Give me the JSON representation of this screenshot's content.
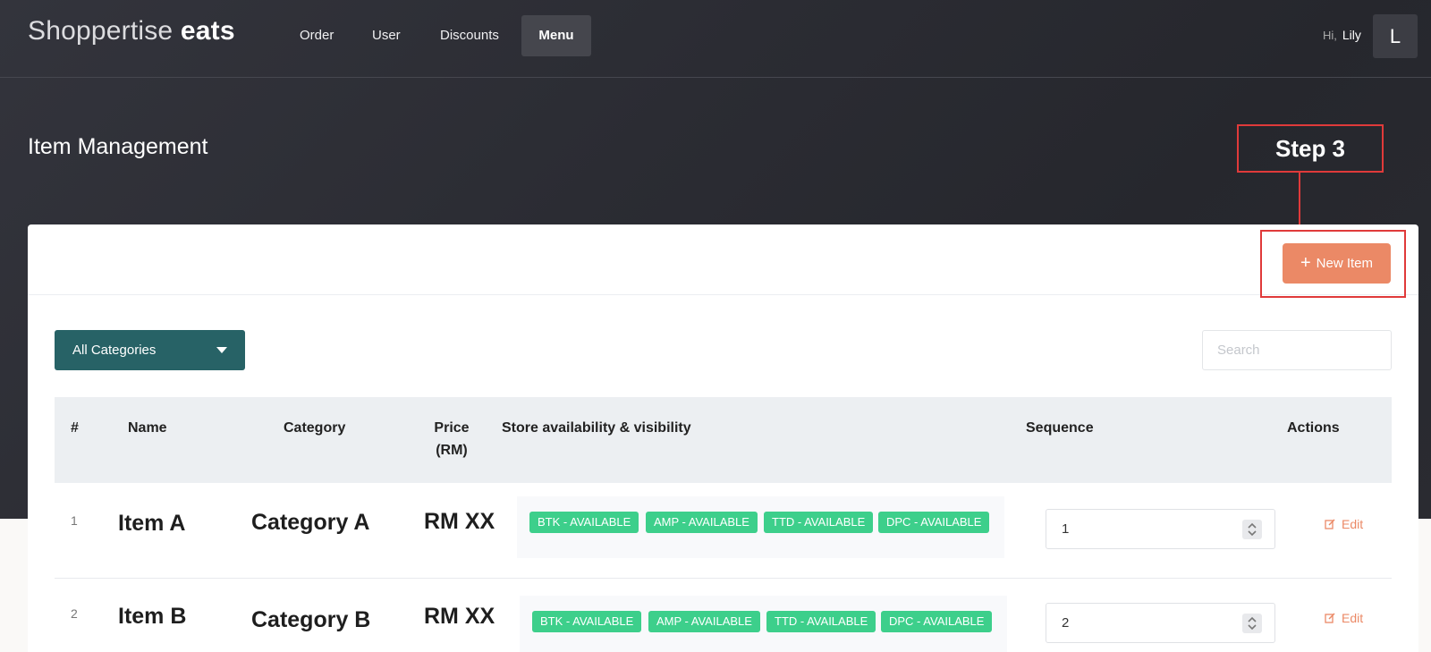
{
  "brand": {
    "light": "Shoppertise",
    "bold": "eats"
  },
  "nav": {
    "items": [
      {
        "label": "Order",
        "active": false
      },
      {
        "label": "User",
        "active": false
      },
      {
        "label": "Discounts",
        "active": false
      },
      {
        "label": "Menu",
        "active": true
      }
    ]
  },
  "user": {
    "greeting": "Hi,",
    "name": "Lily",
    "initial": "L"
  },
  "page": {
    "title": "Item Management"
  },
  "annotation": {
    "step_label": "Step 3"
  },
  "toolbar": {
    "new_item_label": "New Item",
    "plus_icon": "+"
  },
  "filters": {
    "category_selected": "All Categories",
    "search_placeholder": "Search",
    "search_value": ""
  },
  "table": {
    "columns": {
      "index": "#",
      "name": "Name",
      "category": "Category",
      "price_line1": "Price",
      "price_line2": "(RM)",
      "availability": "Store availability & visibility",
      "sequence": "Sequence",
      "actions": "Actions"
    },
    "rows": [
      {
        "index": "1",
        "name": "Item A",
        "category": "Category A",
        "price": "RM XX",
        "badges": [
          "BTK - AVAILABLE",
          "AMP - AVAILABLE",
          "TTD - AVAILABLE",
          "DPC - AVAILABLE"
        ],
        "sequence": "1",
        "action": "Edit"
      },
      {
        "index": "2",
        "name": "Item B",
        "category": "Category B",
        "price": "RM XX",
        "badges": [
          "BTK - AVAILABLE",
          "AMP - AVAILABLE",
          "TTD - AVAILABLE",
          "DPC - AVAILABLE"
        ],
        "sequence": "2",
        "action": "Edit"
      }
    ]
  },
  "colors": {
    "accent_orange": "#eb8966",
    "teal_select": "#276266",
    "badge_green": "#3dcf8b",
    "annotation_red": "#e03a3a"
  }
}
